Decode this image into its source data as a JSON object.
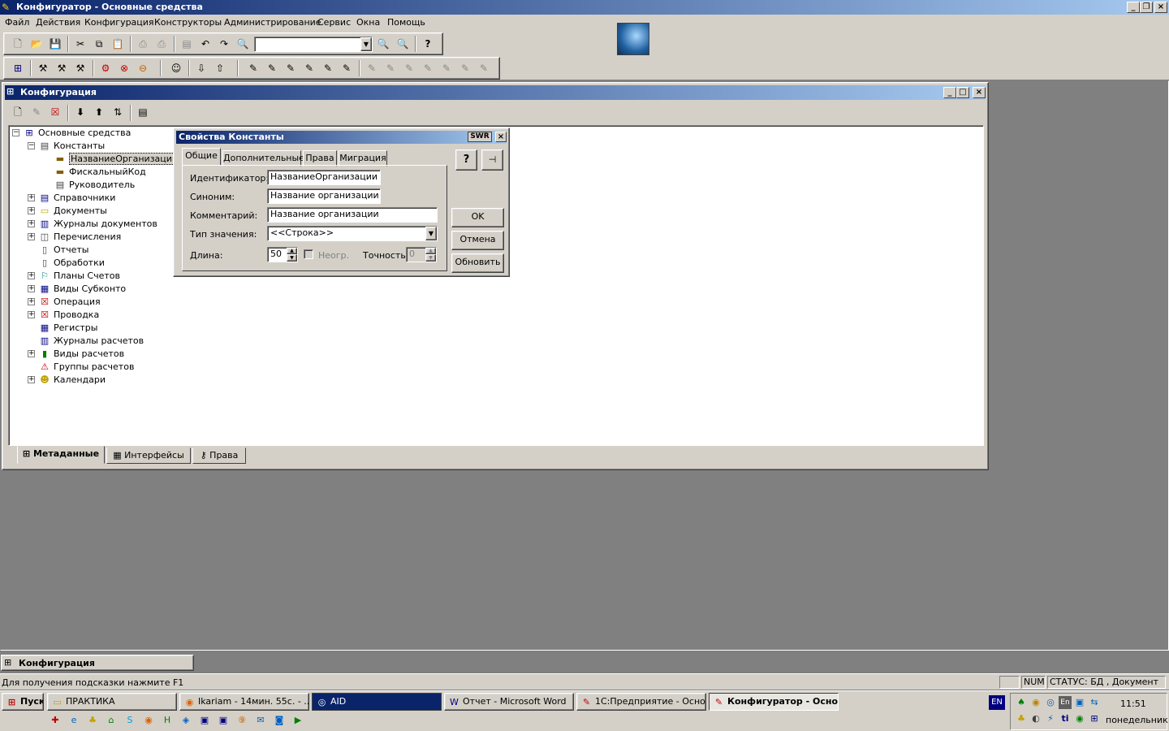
{
  "app": {
    "title": "Конфигуратор - Основные средства",
    "menu": [
      "Файл",
      "Действия",
      "Конфигурация",
      "Конструкторы",
      "Администрирование",
      "Сервис",
      "Окна",
      "Помощь"
    ]
  },
  "config_window": {
    "title": "Конфигурация",
    "tree": [
      {
        "label": "Основные средства",
        "level": 0,
        "expander": "−"
      },
      {
        "label": "Константы",
        "level": 1,
        "expander": "−"
      },
      {
        "label": "НазваниеОрганизации",
        "level": 2,
        "expander": ""
      },
      {
        "label": "ФискальныйКод",
        "level": 2,
        "expander": ""
      },
      {
        "label": "Руководитель",
        "level": 2,
        "expander": ""
      },
      {
        "label": "Справочники",
        "level": 1,
        "expander": "+"
      },
      {
        "label": "Документы",
        "level": 1,
        "expander": "+"
      },
      {
        "label": "Журналы документов",
        "level": 1,
        "expander": "+"
      },
      {
        "label": "Перечисления",
        "level": 1,
        "expander": "+"
      },
      {
        "label": "Отчеты",
        "level": 1,
        "expander": ""
      },
      {
        "label": "Обработки",
        "level": 1,
        "expander": ""
      },
      {
        "label": "Планы Счетов",
        "level": 1,
        "expander": "+"
      },
      {
        "label": "Виды Субконто",
        "level": 1,
        "expander": "+"
      },
      {
        "label": "Операция",
        "level": 1,
        "expander": "+"
      },
      {
        "label": "Проводка",
        "level": 1,
        "expander": "+"
      },
      {
        "label": "Регистры",
        "level": 1,
        "expander": ""
      },
      {
        "label": "Журналы расчетов",
        "level": 1,
        "expander": ""
      },
      {
        "label": "Виды расчетов",
        "level": 1,
        "expander": "+"
      },
      {
        "label": "Группы расчетов",
        "level": 1,
        "expander": ""
      },
      {
        "label": "Календари",
        "level": 1,
        "expander": "+"
      }
    ],
    "bottom_tabs": [
      "Метаданные",
      "Интерфейсы",
      "Права"
    ]
  },
  "dialog": {
    "title": "Свойства Константы",
    "title_buttons": "SWR",
    "tabs": [
      "Общие",
      "Дополнительные",
      "Права",
      "Миграция"
    ],
    "labels": {
      "identifier": "Идентификатор:",
      "synonym": "Синоним:",
      "comment": "Комментарий:",
      "type": "Тип значения:",
      "length": "Длина:",
      "unlimited": "Неогр.",
      "precision": "Точность:"
    },
    "values": {
      "identifier": "НазваниеОрганизации",
      "synonym": "Название организации",
      "comment": "Название организации",
      "type": "<<Строка>>",
      "length": "50",
      "precision": "0"
    },
    "buttons": {
      "ok": "OK",
      "cancel": "Отмена",
      "refresh": "Обновить",
      "help": "?"
    }
  },
  "minimized": {
    "title": "Конфигурация"
  },
  "statusbar": {
    "hint": "Для получения подсказки нажмите F1",
    "num": "NUM",
    "status": "СТАТУС: БД , Документ"
  },
  "taskbar": {
    "start": "Пуск",
    "items": [
      "ПРАКТИКА",
      "Ikariam - 14мин. 55с. - ...",
      "AID",
      "Отчет - Microsoft Word",
      "1С:Предприятие - Осно...",
      "Конфигуратор - Осно..."
    ],
    "lang": "EN",
    "time": "11:51",
    "day": "понедельник"
  }
}
